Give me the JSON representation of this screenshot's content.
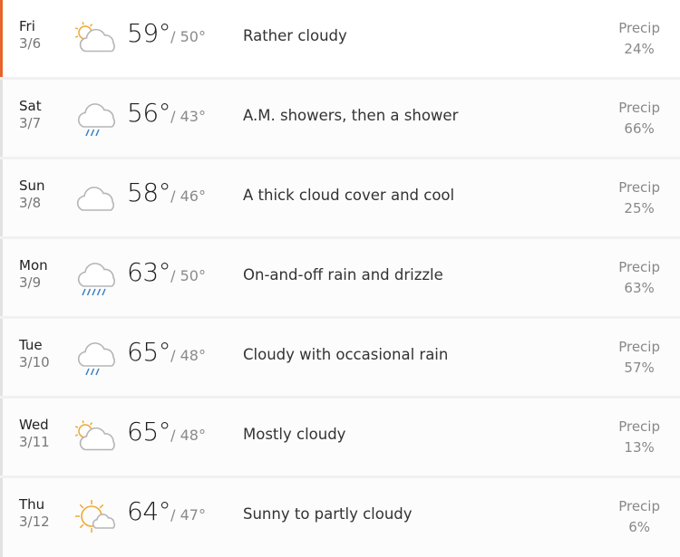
{
  "forecast": [
    {
      "dow": "Fri",
      "date": "3/6",
      "icon": "partly-sunny-cloud-icon",
      "hi": "59°",
      "lo": "/ 50°",
      "phrase": "Rather cloudy",
      "precip_label": "Precip",
      "precip": "24%"
    },
    {
      "dow": "Sat",
      "date": "3/7",
      "icon": "cloud-rain-icon",
      "hi": "56°",
      "lo": "/ 43°",
      "phrase": "A.M. showers, then a shower",
      "precip_label": "Precip",
      "precip": "66%"
    },
    {
      "dow": "Sun",
      "date": "3/8",
      "icon": "cloud-icon",
      "hi": "58°",
      "lo": "/ 46°",
      "phrase": "A thick cloud cover and cool",
      "precip_label": "Precip",
      "precip": "25%"
    },
    {
      "dow": "Mon",
      "date": "3/9",
      "icon": "cloud-heavy-rain-icon",
      "hi": "63°",
      "lo": "/ 50°",
      "phrase": "On-and-off rain and drizzle",
      "precip_label": "Precip",
      "precip": "63%"
    },
    {
      "dow": "Tue",
      "date": "3/10",
      "icon": "cloud-rain-icon",
      "hi": "65°",
      "lo": "/ 48°",
      "phrase": "Cloudy with occasional rain",
      "precip_label": "Precip",
      "precip": "57%"
    },
    {
      "dow": "Wed",
      "date": "3/11",
      "icon": "partly-sunny-cloud-icon",
      "hi": "65°",
      "lo": "/ 48°",
      "phrase": "Mostly cloudy",
      "precip_label": "Precip",
      "precip": "13%"
    },
    {
      "dow": "Thu",
      "date": "3/12",
      "icon": "sunny-small-cloud-icon",
      "hi": "64°",
      "lo": "/ 47°",
      "phrase": "Sunny to partly cloudy",
      "precip_label": "Precip",
      "precip": "6%"
    }
  ],
  "colors": {
    "accent": "#e8632b",
    "sun": "#f0a830",
    "rain": "#3a7fc4",
    "cloud": "#b5b5b5"
  }
}
